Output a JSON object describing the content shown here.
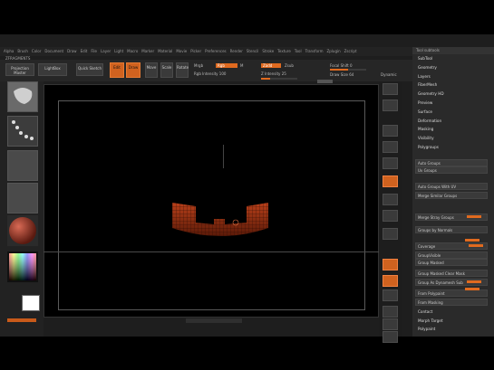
{
  "app": {
    "menu_items": [
      "Alpha",
      "Brush",
      "Color",
      "Document",
      "Draw",
      "Edit",
      "File",
      "Layer",
      "Light",
      "Macro",
      "Marker",
      "Material",
      "Movie",
      "Picker",
      "Preferences",
      "Render",
      "Stencil",
      "Stroke",
      "Texture",
      "Tool",
      "Transform",
      "Zplugin",
      "Zscript"
    ],
    "title_left": "ZFRAGMENTS",
    "right_panel_title": "Tool subtools"
  },
  "toolbar": {
    "projection": "Projection Master",
    "lightbox": "LightBox",
    "quick_sketch": "Quick Sketch",
    "edit": "Edit",
    "draw": "Draw",
    "move": "Move",
    "scale": "Scale",
    "rotate": "Rotate",
    "mrgb": "Mrgb",
    "rgb": "Rgb",
    "m": "M",
    "zadd": "Zadd",
    "zsub": "Zsub",
    "zcut": "Zcut",
    "focal_shift": "Focal Shift 0",
    "draw_size": "Draw Size 64",
    "dynamic": "Dynamic",
    "rgb_intensity": "Rgb Intensity 100",
    "z_intensity": "Z Intensity 25"
  },
  "right_panel": {
    "items": [
      "SubTool",
      "Geometry",
      "Layers",
      "FiberMesh",
      "Geometry HD",
      "Preview",
      "Surface",
      "Deformation",
      "Masking",
      "Visibility",
      "Polygroups"
    ],
    "buttons": [
      "Auto Groups",
      "Uv Groups",
      "Auto Groups With UV",
      "Merge Similar Groups",
      "Merge Stray Groups",
      "Groups by Normals",
      "Coverage",
      "GroupVisible",
      "Group Masked",
      "Group Masked Clear Mask",
      "Group As Dynamesh Sub",
      "From Polypaint",
      "From Masking"
    ],
    "bottom_items": [
      "Contact",
      "Morph Target",
      "Polypaint"
    ]
  },
  "colors": {
    "accent": "#e06a1f",
    "panel": "#2a2a2a",
    "background": "#000000"
  }
}
